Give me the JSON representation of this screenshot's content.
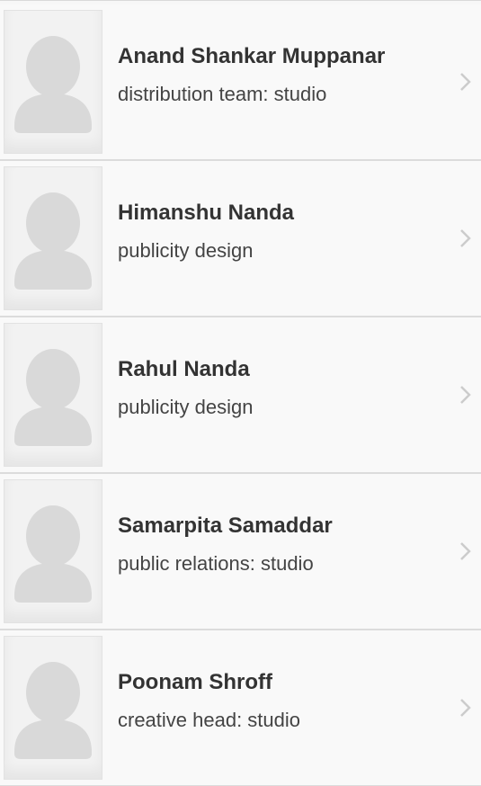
{
  "people": [
    {
      "name": "Anand Shankar Muppanar",
      "role": "distribution team: studio",
      "avatar_icon": "person-placeholder-icon"
    },
    {
      "name": "Himanshu Nanda",
      "role": "publicity design",
      "avatar_icon": "person-placeholder-icon"
    },
    {
      "name": "Rahul Nanda",
      "role": "publicity design",
      "avatar_icon": "person-placeholder-icon"
    },
    {
      "name": "Samarpita Samaddar",
      "role": "public relations: studio",
      "avatar_icon": "person-placeholder-icon"
    },
    {
      "name": "Poonam Shroff",
      "role": "creative head: studio",
      "avatar_icon": "person-placeholder-icon"
    }
  ],
  "colors": {
    "background": "#f9f9f9",
    "divider": "#dcdcdc",
    "name_text": "#333333",
    "role_text": "#444444",
    "placeholder": "#d9d9d9",
    "chevron": "#cccccc"
  }
}
